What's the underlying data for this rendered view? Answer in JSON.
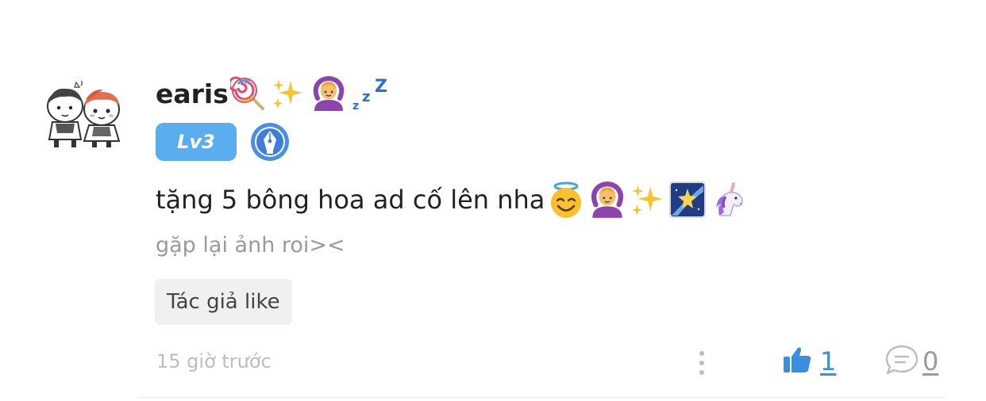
{
  "comment": {
    "username": "earis",
    "username_emojis": [
      "lollipop-icon",
      "sparkles-icon",
      "person-gesturing-ok-icon",
      "zzz-icon"
    ],
    "level_badge": "Lv3",
    "level_badge_color": "#5aaef0",
    "text": "tặng 5 bông hoa ad cố lên nha",
    "text_emojis": [
      "smiling-face-with-halo-icon",
      "person-gesturing-ok-icon",
      "sparkles-icon",
      "milky-way-icon",
      "unicorn-icon"
    ],
    "reply_preview": "gặp lại ảnh roi><",
    "author_like_tag": "Tác giả like",
    "timestamp": "15 giờ trước",
    "like_count": "1",
    "reply_count": "0",
    "accent_color": "#3a8de0"
  }
}
